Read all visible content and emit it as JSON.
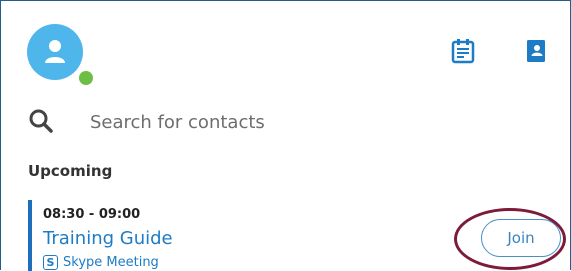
{
  "header": {
    "avatar_icon": "user-silhouette-icon",
    "presence_status": "available",
    "presence_color": "#6cbe45",
    "meetings_icon": "calendar-icon",
    "contacts_icon": "contacts-book-icon"
  },
  "search": {
    "icon": "search-icon",
    "placeholder": "Search for contacts"
  },
  "upcoming": {
    "heading": "Upcoming",
    "meetings": [
      {
        "time": "08:30 - 09:00",
        "title": "Training Guide",
        "type_badge": "S",
        "type_label": "Skype Meeting",
        "join_label": "Join"
      }
    ]
  },
  "colors": {
    "accent": "#1e7cc4",
    "avatar": "#4fb6ec",
    "highlight": "#7d1b3a"
  }
}
